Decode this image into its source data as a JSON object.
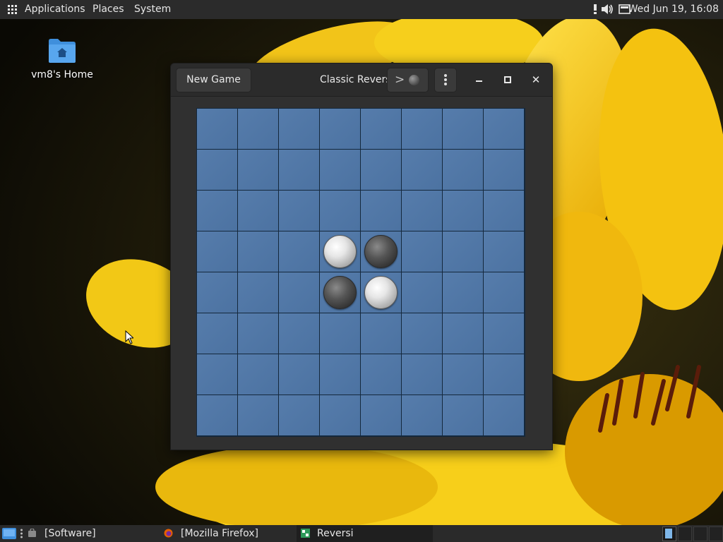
{
  "top_panel": {
    "menus": [
      "Applications",
      "Places",
      "System"
    ],
    "clock": "Wed Jun 19, 16:08",
    "tray_icons": [
      "notification-icon",
      "volume-icon",
      "keyboard-icon"
    ]
  },
  "desktop": {
    "icons": [
      {
        "label": "vm8's Home",
        "icon": "home-folder-icon"
      }
    ]
  },
  "window": {
    "title": "Classic Reversi",
    "new_game_label": "New Game",
    "history_icon": "chevron-right-icon",
    "current_player": "black",
    "menu_icon": "vertical-dots-icon",
    "controls": [
      "minimize-icon",
      "maximize-icon",
      "close-icon"
    ],
    "board": {
      "size": 8,
      "pieces": [
        {
          "row": 3,
          "col": 3,
          "color": "white"
        },
        {
          "row": 3,
          "col": 4,
          "color": "black"
        },
        {
          "row": 4,
          "col": 3,
          "color": "black"
        },
        {
          "row": 4,
          "col": 4,
          "color": "white"
        }
      ],
      "cell_color": "#4f77a8",
      "grid_color": "#14283c"
    }
  },
  "taskbar": {
    "items": [
      {
        "label": "[Software]",
        "icon": "software-icon",
        "active": false
      },
      {
        "label": "[Mozilla Firefox]",
        "icon": "firefox-icon",
        "active": false
      },
      {
        "label": "Reversi",
        "icon": "reversi-icon",
        "active": true
      }
    ]
  }
}
